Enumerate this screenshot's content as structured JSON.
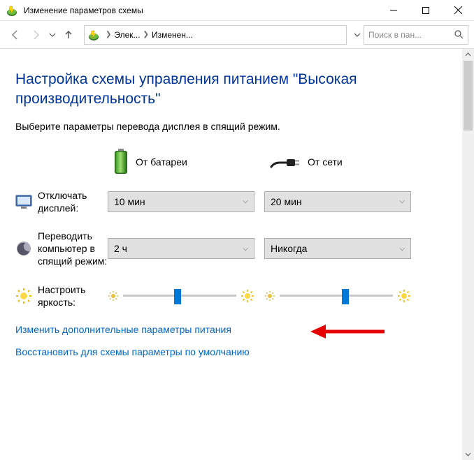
{
  "window": {
    "title": "Изменение параметров схемы"
  },
  "breadcrumb": {
    "item1": "Элек...",
    "item2": "Изменен..."
  },
  "search": {
    "placeholder": "Поиск в пан..."
  },
  "page": {
    "heading": "Настройка схемы управления питанием \"Высокая производительность\"",
    "instruction": "Выберите параметры перевода дисплея в спящий режим."
  },
  "columns": {
    "battery": "От батареи",
    "plugged": "От сети"
  },
  "rows": {
    "display_off": {
      "label": "Отключать дисплей:",
      "battery_value": "10 мин",
      "plugged_value": "20 мин"
    },
    "sleep": {
      "label": "Переводить компьютер в спящий режим:",
      "battery_value": "2 ч",
      "plugged_value": "Никогда"
    },
    "brightness": {
      "label": "Настроить яркость:",
      "battery_percent": 45,
      "plugged_percent": 55
    }
  },
  "links": {
    "advanced": "Изменить дополнительные параметры питания",
    "restore": "Восстановить для схемы параметры по умолчанию"
  }
}
